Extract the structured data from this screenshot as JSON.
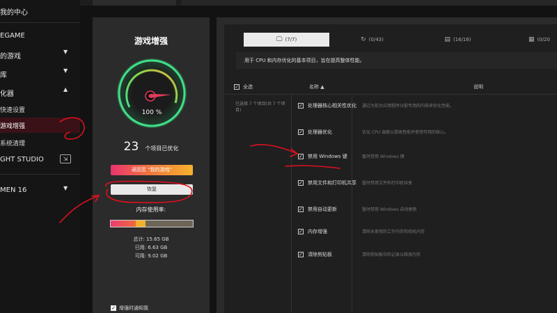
{
  "sidebar": {
    "items": [
      {
        "label": "我的中心",
        "chevron": ""
      },
      {
        "label": "EGAME",
        "chevron": ""
      },
      {
        "label": "的游戏",
        "chevron": "▼"
      },
      {
        "label": "库",
        "chevron": "▼"
      },
      {
        "label": "化器",
        "chevron": "▲"
      },
      {
        "label": "快速设置",
        "chevron": ""
      },
      {
        "label": "游戏增强",
        "chevron": ""
      },
      {
        "label": "系统清理",
        "chevron": ""
      },
      {
        "label": "GHT STUDIO",
        "chevron": ""
      },
      {
        "label": "MEN 16",
        "chevron": "▼"
      }
    ]
  },
  "boost": {
    "title": "游戏增强",
    "percent": "100 %",
    "percent_value": 100,
    "optimized_count": "23",
    "optimized_text": "个项目已优化",
    "return_button": "返回至 \"我的游戏\"",
    "restore_button": "恢复",
    "memory_label": "内存使用率:",
    "memory_used_fraction": 0.42,
    "memory_total": "总计: 15.65 GB",
    "memory_used": "已用: 6.63 GB",
    "memory_available": "可用: 9.02 GB",
    "notify_label": "增强时通知我",
    "notify_checked": true
  },
  "tabs": [
    {
      "icon": "monitor-icon",
      "glyph": "🖵",
      "label": "(7/7)",
      "selected": true
    },
    {
      "icon": "refresh-icon",
      "glyph": "↻",
      "label": "(0/43)",
      "selected": false
    },
    {
      "icon": "document-icon",
      "glyph": "▤",
      "label": "(16/16)",
      "selected": false
    },
    {
      "icon": "grid-icon",
      "glyph": "▦",
      "label": "(0/20",
      "selected": false
    }
  ],
  "description": "用于 CPU 和内存优化的基本项目，旨在提高整体性能。",
  "table": {
    "select_all": "全选",
    "col_name": "名称",
    "col_note": "说明",
    "selected_info": "已选择 7 个项目(共 7 个项目)",
    "rows": [
      {
        "name": "处理器核心相关性优化",
        "desc": "通过为前台应用程序分配专用的内核来优化性能。",
        "checked": true
      },
      {
        "name": "处理器优化",
        "desc": "优化 CPU 调度以提高性能并使用可用的核心。",
        "checked": true
      },
      {
        "name": "禁用 Windows 键",
        "desc": "暂时禁用 Windows 键",
        "checked": true
      },
      {
        "name": "禁用文件和打印机共享",
        "desc": "暂时禁用文件和打印机共享",
        "checked": true
      },
      {
        "name": "禁用自动更新",
        "desc": "暂时禁用 Windows 自动更新",
        "checked": true
      },
      {
        "name": "内存增强",
        "desc": "清除未使用的工作内存和待机内存",
        "checked": true
      },
      {
        "name": "清除剪贴板",
        "desc": "清除剪贴板中的记录以释放内存",
        "checked": true
      }
    ]
  },
  "colors": {
    "accent_red": "#e8336f",
    "accent_orange": "#f6b12e",
    "gauge_green": "#3fe088",
    "annotation_red": "#e0101e"
  }
}
